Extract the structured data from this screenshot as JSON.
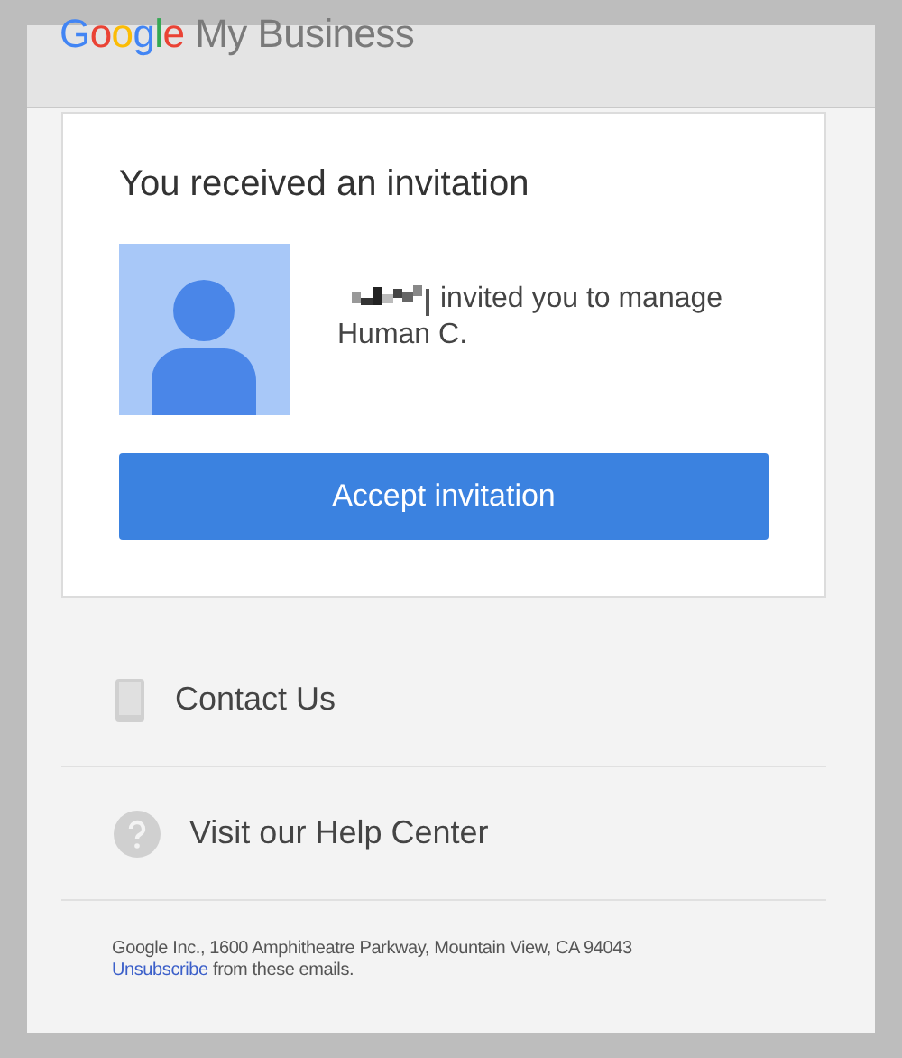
{
  "header": {
    "logo_brand": "Google",
    "logo_product": "My Business"
  },
  "card": {
    "title": "You received an invitation",
    "message_line_1": "invited you to manage",
    "message_line_2": "Human C.",
    "button": "Accept invitation"
  },
  "links": [
    {
      "kind": "phone",
      "label": "Contact Us"
    },
    {
      "kind": "help",
      "label": "Visit our Help Center"
    }
  ],
  "footer": {
    "address": "Google Inc., 1600 Amphitheatre Parkway, Mountain View, CA 94043",
    "unsubscribe": "Unsubscribe",
    "unsubscribe_rest": "from these emails."
  }
}
